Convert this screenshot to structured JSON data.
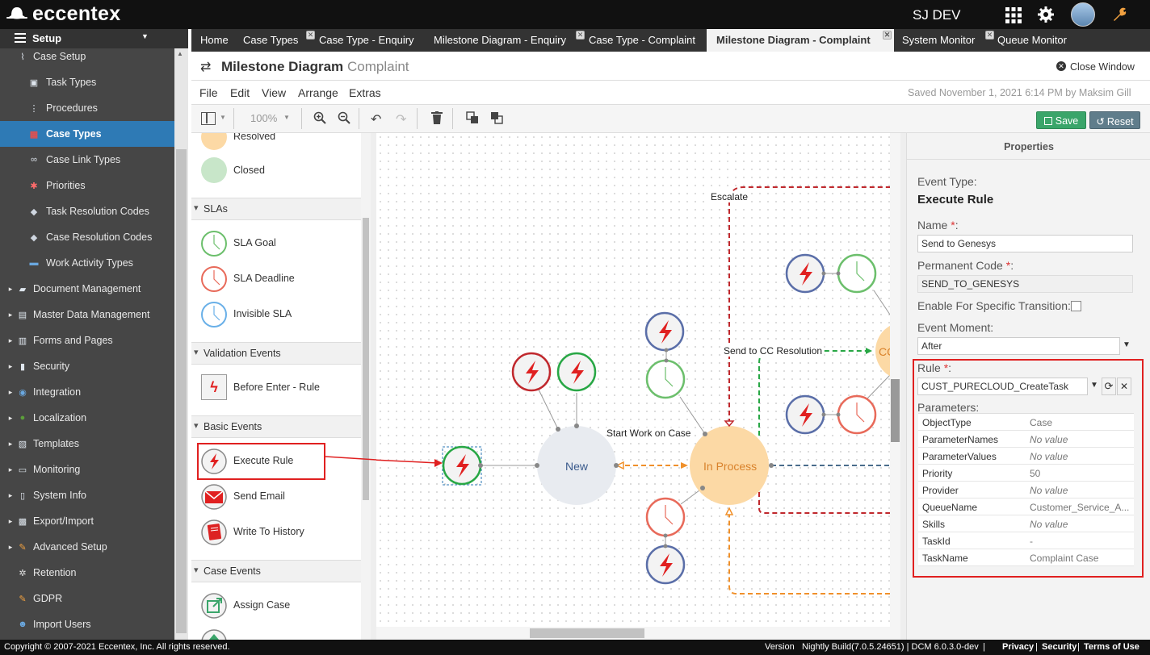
{
  "brand": {
    "name": "eccentex"
  },
  "user": {
    "name": "SJ DEV"
  },
  "sidebar": {
    "header": "Setup",
    "items": [
      {
        "label": "Case Setup",
        "icon": "pin-icon"
      },
      {
        "label": "Task Types",
        "icon": "cube-icon"
      },
      {
        "label": "Procedures",
        "icon": "procedure-icon"
      },
      {
        "label": "Case Types",
        "icon": "cubes-icon"
      },
      {
        "label": "Case Link Types",
        "icon": "link-icon"
      },
      {
        "label": "Priorities",
        "icon": "asterisk-icon"
      },
      {
        "label": "Task Resolution Codes",
        "icon": "tag-icon"
      },
      {
        "label": "Case Resolution Codes",
        "icon": "tag-icon"
      },
      {
        "label": "Work Activity Types",
        "icon": "briefcase-icon"
      },
      {
        "label": "Document Management",
        "icon": "folder-icon"
      },
      {
        "label": "Master Data Management",
        "icon": "database-icon"
      },
      {
        "label": "Forms and Pages",
        "icon": "forms-icon"
      },
      {
        "label": "Security",
        "icon": "lock-icon"
      },
      {
        "label": "Integration",
        "icon": "integration-icon"
      },
      {
        "label": "Localization",
        "icon": "globe-icon"
      },
      {
        "label": "Templates",
        "icon": "template-icon"
      },
      {
        "label": "Monitoring",
        "icon": "monitor-icon"
      },
      {
        "label": "System Info",
        "icon": "terminal-icon"
      },
      {
        "label": "Export/Import",
        "icon": "export-icon"
      },
      {
        "label": "Advanced Setup",
        "icon": "wrench-icon"
      },
      {
        "label": "Retention",
        "icon": "gear-icon"
      },
      {
        "label": "GDPR",
        "icon": "gdpr-icon"
      },
      {
        "label": "Import Users",
        "icon": "users-icon"
      }
    ]
  },
  "tabs": [
    {
      "label": "Home"
    },
    {
      "label": "Case Types"
    },
    {
      "label": "Case Type - Enquiry"
    },
    {
      "label": "Milestone Diagram - Enquiry"
    },
    {
      "label": "Case Type - Complaint"
    },
    {
      "label": "Milestone Diagram - Complaint"
    },
    {
      "label": "System Monitor"
    },
    {
      "label": "Queue Monitor"
    }
  ],
  "page": {
    "title": "Milestone Diagram",
    "subtitle": "Complaint",
    "close_label": "Close Window"
  },
  "menu": {
    "file": "File",
    "edit": "Edit",
    "view": "View",
    "arrange": "Arrange",
    "extras": "Extras",
    "saved": "Saved November 1, 2021 6:14 PM by Maksim Gill"
  },
  "toolbar": {
    "zoom": "100%",
    "save_label": "Save",
    "reset_label": "Reset"
  },
  "palette": {
    "resolved": "Resolved",
    "closed": "Closed",
    "slas": "SLAs",
    "sla_goal": "SLA Goal",
    "sla_deadline": "SLA Deadline",
    "invisible_sla": "Invisible SLA",
    "validation_events": "Validation Events",
    "before_enter": "Before Enter - Rule",
    "basic_events": "Basic Events",
    "execute_rule": "Execute Rule",
    "send_email": "Send Email",
    "write_history": "Write To History",
    "case_events": "Case Events",
    "assign_case": "Assign Case"
  },
  "diagram": {
    "escalate": "Escalate",
    "send_to_cc": "Send to CC Resolution",
    "start_work": "Start Work on Case",
    "new": "New",
    "in_process": "In Process",
    "cc": "CC"
  },
  "properties": {
    "title": "Properties",
    "event_type_label": "Event Type:",
    "event_type": "Execute Rule",
    "name_label": "Name",
    "name_value": "Send to Genesys",
    "code_label": "Permanent Code",
    "code_value": "SEND_TO_GENESYS",
    "enable_label": "Enable For Specific Transition:",
    "moment_label": "Event Moment:",
    "moment_value": "After",
    "rule_label": "Rule",
    "rule_value": "CUST_PURECLOUD_CreateTask",
    "params_label": "Parameters:",
    "params": [
      {
        "k": "ObjectType",
        "v": "Case",
        "nv": false
      },
      {
        "k": "ParameterNames",
        "v": "No value",
        "nv": true
      },
      {
        "k": "ParameterValues",
        "v": "No value",
        "nv": true
      },
      {
        "k": "Priority",
        "v": "50",
        "nv": false
      },
      {
        "k": "Provider",
        "v": "No value",
        "nv": true
      },
      {
        "k": "QueueName",
        "v": "Customer_Service_A...",
        "nv": false
      },
      {
        "k": "Skills",
        "v": "No value",
        "nv": true
      },
      {
        "k": "TaskId",
        "v": "-",
        "nv": false
      },
      {
        "k": "TaskName",
        "v": "Complaint Case",
        "nv": false
      }
    ]
  },
  "footer": {
    "copyright": "Copyright © 2007-2021 Eccentex, Inc. All rights reserved.",
    "version_label": "Version",
    "version": "Nightly Build(7.0.5.24651) | DCM 6.0.3.0-dev",
    "privacy": "Privacy",
    "security": "Security",
    "terms": "Terms of Use"
  },
  "colors": {
    "accent": "#2e7ab5",
    "highlight_red": "#e02020",
    "save_green": "#3aa56a",
    "reset_gray": "#607d8b",
    "in_process": "#fcd9a5",
    "new_node": "#e8ebf0"
  }
}
